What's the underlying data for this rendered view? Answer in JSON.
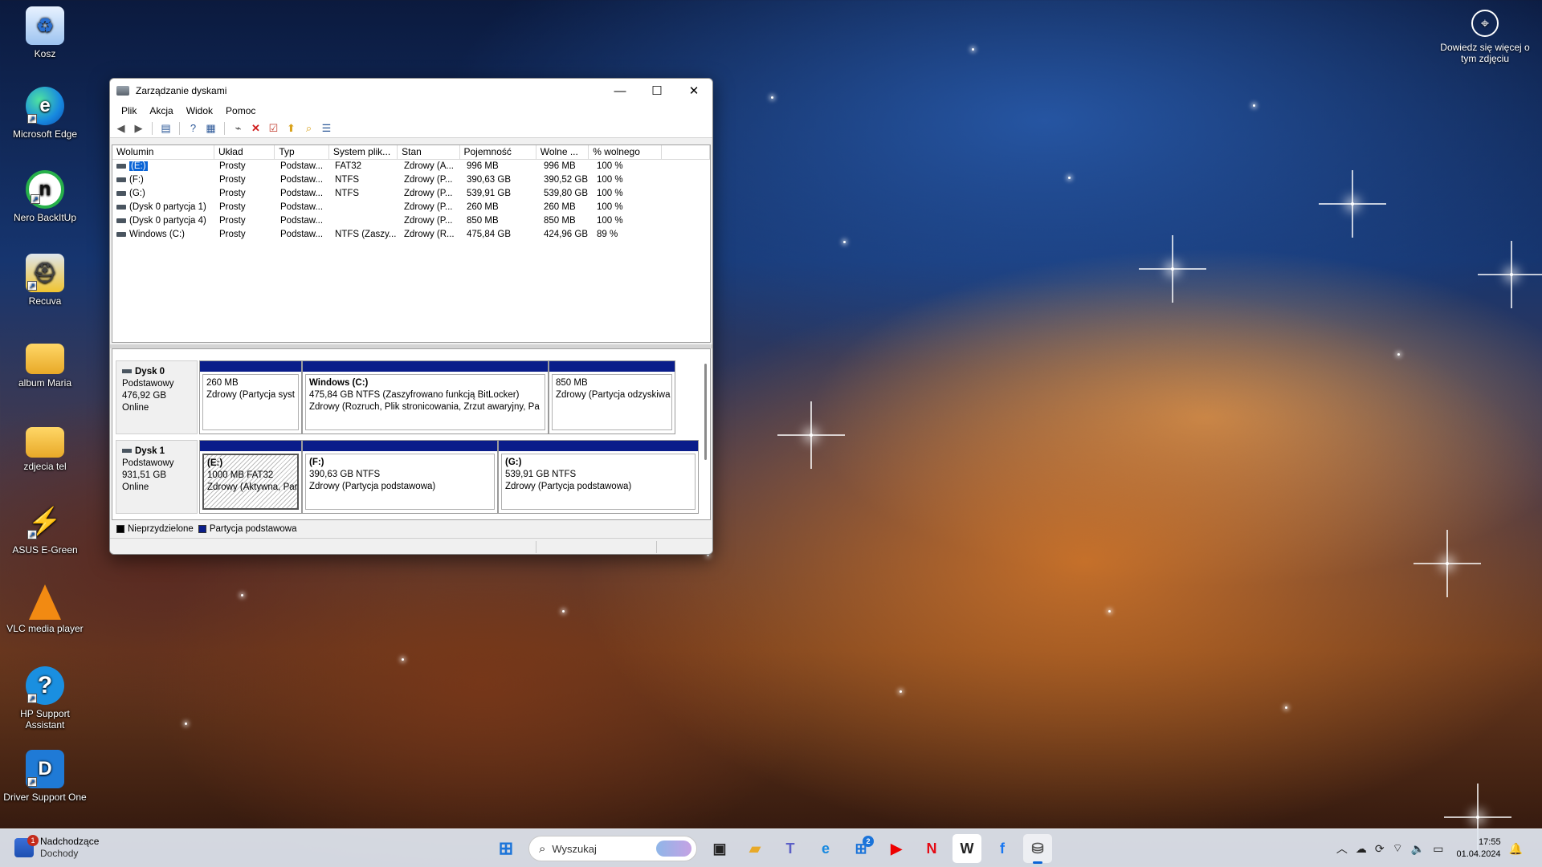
{
  "desktop": {
    "icons": [
      {
        "label": "Kosz",
        "icon": "recycle-bin-icon"
      },
      {
        "label": "Microsoft Edge",
        "icon": "edge-icon"
      },
      {
        "label": "Nero BackItUp",
        "icon": "nero-icon"
      },
      {
        "label": "Recuva",
        "icon": "recuva-icon"
      },
      {
        "label": "album Maria",
        "icon": "folder-icon"
      },
      {
        "label": "zdjecia tel",
        "icon": "folder-icon"
      },
      {
        "label": "ASUS E-Green",
        "icon": "asus-egreen-icon"
      },
      {
        "label": "VLC media player",
        "icon": "vlc-icon"
      },
      {
        "label": "HP Support Assistant",
        "icon": "hp-support-icon"
      },
      {
        "label": "Driver Support One",
        "icon": "driver-support-icon"
      }
    ],
    "learn_more": "Dowiedz się więcej o tym zdjęciu"
  },
  "window": {
    "title": "Zarządzanie dyskami",
    "menu": [
      "Plik",
      "Akcja",
      "Widok",
      "Pomoc"
    ],
    "columns": [
      "Wolumin",
      "Układ",
      "Typ",
      "System plik...",
      "Stan",
      "Pojemność",
      "Wolne ...",
      "% wolnego"
    ],
    "rows": [
      [
        "(E:)",
        "Prosty",
        "Podstaw...",
        "FAT32",
        "Zdrowy (A...",
        "996 MB",
        "996 MB",
        "100 %"
      ],
      [
        "(F:)",
        "Prosty",
        "Podstaw...",
        "NTFS",
        "Zdrowy (P...",
        "390,63 GB",
        "390,52 GB",
        "100 %"
      ],
      [
        "(G:)",
        "Prosty",
        "Podstaw...",
        "NTFS",
        "Zdrowy (P...",
        "539,91 GB",
        "539,80 GB",
        "100 %"
      ],
      [
        "(Dysk 0 partycja 1)",
        "Prosty",
        "Podstaw...",
        "",
        "Zdrowy (P...",
        "260 MB",
        "260 MB",
        "100 %"
      ],
      [
        "(Dysk 0 partycja 4)",
        "Prosty",
        "Podstaw...",
        "",
        "Zdrowy (P...",
        "850 MB",
        "850 MB",
        "100 %"
      ],
      [
        "Windows (C:)",
        "Prosty",
        "Podstaw...",
        "NTFS (Zaszy...",
        "Zdrowy (R...",
        "475,84 GB",
        "424,96 GB",
        "89 %"
      ]
    ],
    "disks": [
      {
        "name": "Dysk 0",
        "type": "Podstawowy",
        "size": "476,92 GB",
        "status": "Online",
        "partitions": [
          {
            "name": "",
            "line1": "260 MB",
            "line2": "Zdrowy (Partycja syst"
          },
          {
            "name": "Windows  (C:)",
            "line1": "475,84 GB NTFS (Zaszyfrowano funkcją BitLocker)",
            "line2": "Zdrowy (Rozruch, Plik stronicowania, Zrzut awaryjny, Pa"
          },
          {
            "name": "",
            "line1": "850 MB",
            "line2": "Zdrowy (Partycja odzyskiwa"
          }
        ]
      },
      {
        "name": "Dysk 1",
        "type": "Podstawowy",
        "size": "931,51 GB",
        "status": "Online",
        "partitions": [
          {
            "name": "(E:)",
            "line1": "1000 MB FAT32",
            "line2": "Zdrowy (Aktywna, Par"
          },
          {
            "name": "(F:)",
            "line1": "390,63 GB NTFS",
            "line2": "Zdrowy (Partycja podstawowa)"
          },
          {
            "name": "(G:)",
            "line1": "539,91 GB NTFS",
            "line2": "Zdrowy (Partycja podstawowa)"
          }
        ]
      }
    ],
    "legend": {
      "unallocated": "Nieprzydzielone",
      "primary": "Partycja podstawowa",
      "unallocated_color": "#000000",
      "primary_color": "#0a1d8a"
    }
  },
  "taskbar": {
    "weather_title": "Nadchodzące",
    "weather_sub": "Dochody",
    "weather_badge": "1",
    "search_placeholder": "Wyszukaj",
    "store_badge": "2",
    "time": "17:55",
    "date": "01.04.2024"
  }
}
